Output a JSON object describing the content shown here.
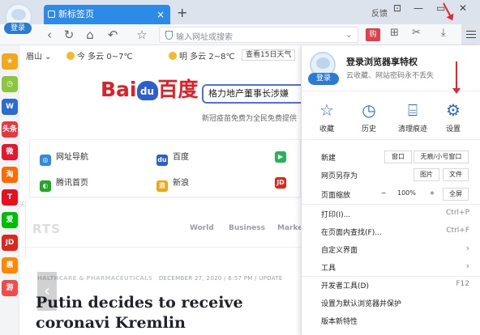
{
  "browser": {
    "login_label": "登录",
    "tab_title": "新标签页",
    "feedback_label": "反馈",
    "address_placeholder": "输入网址或搜索",
    "toolbar_red_icon_label": "购"
  },
  "weather": {
    "city": "眉山",
    "today": "今 多云 0~7℃",
    "tomorrow": "明 多云 2~8℃",
    "forecast_button": "查看15日天气"
  },
  "sidebar": {
    "items": [
      {
        "icon": "star-icon",
        "label": "★",
        "color": "#f2a81d"
      },
      {
        "icon": "clock-icon",
        "label": "◷",
        "color": "#8cc63f"
      },
      {
        "icon": "word-icon",
        "label": "W",
        "color": "#2b6cd4"
      },
      {
        "icon": "toutiao-icon",
        "label": "头条",
        "color": "#e8383d"
      },
      {
        "icon": "weibo-icon",
        "label": "微",
        "color": "#e6162d"
      },
      {
        "icon": "taobao-icon",
        "label": "淘",
        "color": "#ff6a00"
      },
      {
        "icon": "tmall-icon",
        "label": "T",
        "color": "#e8101f"
      },
      {
        "icon": "iqiyi-icon",
        "label": "爱",
        "color": "#00be06"
      },
      {
        "icon": "jd-icon",
        "label": "JD",
        "color": "#e1251b"
      },
      {
        "icon": "shop-icon",
        "label": "惠",
        "color": "#ff8800"
      },
      {
        "icon": "game-icon",
        "label": "游",
        "color": "#f04b4b"
      }
    ]
  },
  "baidu": {
    "logo_text_left": "Bai",
    "logo_paw_text": "du",
    "logo_text_right": "百度",
    "search_query": "格力地产董事长涉嫌",
    "tip": "新冠疫苗免费为全民免费提供"
  },
  "quick_links": [
    {
      "label": "网址导航",
      "icon": "nav-icon",
      "color": "#2d8ae6",
      "glyph": "◎"
    },
    {
      "label": "百度",
      "icon": "baidu-paw-icon",
      "color": "#2a5fcf",
      "glyph": "du"
    },
    {
      "label": "",
      "icon": "game-controller-icon",
      "color": "#27b35a",
      "glyph": "▶"
    },
    {
      "label": "腾讯首页",
      "icon": "tencent-icon",
      "color": "#1aad19",
      "glyph": "◐"
    },
    {
      "label": "新浪",
      "icon": "sina-icon",
      "color": "#f0a60f",
      "glyph": "浪"
    },
    {
      "label": "",
      "icon": "jd-icon",
      "color": "#e1251b",
      "glyph": "JD"
    }
  ],
  "news": {
    "site_logo": "RTS",
    "nav": [
      "World",
      "Business",
      "Marke"
    ],
    "kicker_category": "HALTHCARE & PHARMACEUTICALS",
    "kicker_date": "DECEMBER 27, 2020 / 6:57 PM / UPDATE",
    "headline": "Putin decides to receive coronavi Kremlin",
    "left_scroll_label": "天"
  },
  "menu": {
    "login_label": "登录",
    "title": "登录浏览器享特权",
    "subtitle": "云收藏、网站密码永不丢失",
    "features": [
      {
        "label": "收藏",
        "icon": "star-outline-icon",
        "glyph": "☆"
      },
      {
        "label": "历史",
        "icon": "history-clock-icon",
        "glyph": "◷"
      },
      {
        "label": "清理痕迹",
        "icon": "broom-icon",
        "glyph": "⌸"
      },
      {
        "label": "设置",
        "icon": "gear-icon",
        "glyph": "⚙"
      }
    ],
    "new_label": "新建",
    "new_window": "窗口",
    "new_incognito": "无痕/小号窗口",
    "save_as_label": "网页另存为",
    "save_image": "图片",
    "save_file": "文件",
    "zoom_label": "页面缩放",
    "zoom_minus": "−",
    "zoom_value": "100%",
    "zoom_plus": "+",
    "fullscreen": "全屏",
    "items": [
      {
        "label": "打印(I)...",
        "shortcut": "Ctrl+P",
        "arrow": false
      },
      {
        "label": "在页面内查找(F)...",
        "shortcut": "Ctrl+F",
        "arrow": false
      },
      {
        "label": "自定义界面",
        "shortcut": "",
        "arrow": true
      },
      {
        "label": "工具",
        "shortcut": "",
        "arrow": true
      },
      {
        "label": "开发者工具(D)",
        "shortcut": "F12",
        "arrow": false
      },
      {
        "label": "设置为默认浏览器并保护",
        "shortcut": "",
        "arrow": false
      },
      {
        "label": "版本新特性",
        "shortcut": "",
        "arrow": false
      }
    ]
  }
}
